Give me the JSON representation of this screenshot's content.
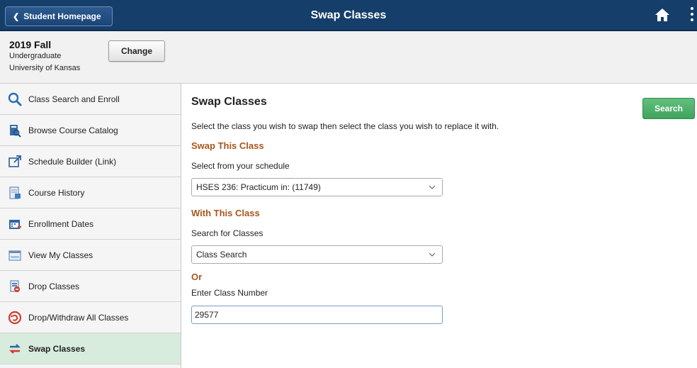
{
  "header": {
    "back_label": "Student Homepage",
    "title": "Swap Classes",
    "home_icon": "home-icon",
    "menu_icon": "kebab-menu-icon"
  },
  "term": {
    "name": "2019 Fall",
    "career": "Undergraduate",
    "institution": "University of Kansas",
    "change_label": "Change"
  },
  "sidebar": {
    "items": [
      {
        "label": "Class Search and Enroll",
        "icon": "magnifier-icon"
      },
      {
        "label": "Browse Course Catalog",
        "icon": "catalog-icon"
      },
      {
        "label": "Schedule Builder (Link)",
        "icon": "external-link-icon"
      },
      {
        "label": "Course History",
        "icon": "course-history-icon"
      },
      {
        "label": "Enrollment Dates",
        "icon": "calendar-icon"
      },
      {
        "label": "View My Classes",
        "icon": "schedule-icon"
      },
      {
        "label": "Drop Classes",
        "icon": "drop-icon"
      },
      {
        "label": "Drop/Withdraw All Classes",
        "icon": "withdraw-icon"
      },
      {
        "label": "Swap Classes",
        "icon": "swap-icon",
        "active": true
      }
    ]
  },
  "main": {
    "title": "Swap Classes",
    "search_label": "Search",
    "instruction": "Select the class you wish to swap then select the class you wish to replace it with.",
    "swap_heading": "Swap This Class",
    "schedule_label": "Select from your schedule",
    "schedule_value": "HSES 236: Practicum in: (11749)",
    "with_heading": "With This Class",
    "search_classes_label": "Search for Classes",
    "search_classes_value": "Class Search",
    "or_label": "Or",
    "class_number_label": "Enter Class Number",
    "class_number_value": "29577"
  },
  "colors": {
    "header_bg": "#153e6b",
    "accent_orange": "#a8561d",
    "search_green": "#3fa45d",
    "active_nav": "#d8ecdd"
  }
}
